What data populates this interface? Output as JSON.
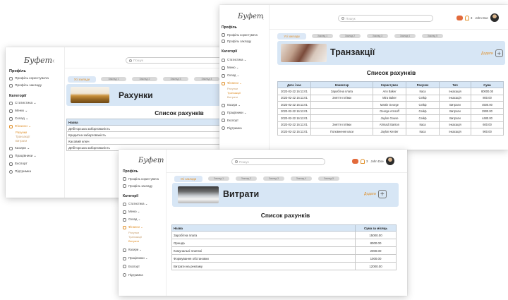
{
  "common": {
    "logo": "Буфет",
    "collapse": "‹",
    "profile_section": "Профіль",
    "profile_items": [
      "Профіль користувача",
      "Профіль закладу"
    ],
    "categories_section": "Категорії",
    "search_placeholder": "Пошук",
    "cart_count": "3",
    "user_name": "John Doe",
    "add_label": "Додати",
    "plus": "+",
    "tabs": [
      "Усі заклади",
      "Заклад 1",
      "Заклад 2",
      "Заклад 3",
      "Заклад 4",
      "Заклад 5"
    ],
    "accent": "#e0902a"
  },
  "window_accounts": {
    "sidebar": [
      "Статистика ⌄",
      "Меню ⌄",
      "Склад ⌄",
      "Фінанси ⌄",
      "Касири ⌄",
      "Працівники ⌄",
      "Експорт",
      "Підтримка"
    ],
    "finance_sub": [
      "Рахунки",
      "Транзакції",
      "Витрати"
    ],
    "banner_title": "Рахунки",
    "list_title": "Список рахунків",
    "table_header": [
      "Назва"
    ],
    "rows": [
      [
        "Дебіторська заборгованість"
      ],
      [
        "Кредитна заборгованість"
      ],
      [
        "Касовий ключ"
      ],
      [
        "Дебіторська заборгованість"
      ]
    ]
  },
  "window_transactions": {
    "sidebar": [
      "Статистика ⌄",
      "Меню ⌄",
      "Склад ⌄",
      "Фінанси ⌄",
      "Касири ⌄",
      "Працівники ⌄",
      "Експорт",
      "Підтримка"
    ],
    "finance_sub": [
      "Рахунки",
      "Транзакції",
      "Витрати"
    ],
    "banner_title": "Транзакції",
    "list_title": "Список рахунків",
    "table_header": [
      "Дата і час",
      "Коментар",
      "Користувач",
      "Рахунок",
      "Тип",
      "Сума"
    ],
    "rows": [
      [
        "2023-02-22 16:11:01",
        "Заробітна плата",
        "Ann Baker",
        "Каса",
        "Інкасація",
        "80000.00"
      ],
      [
        "2023-02-22 16:11:01",
        "Зняття готівки",
        "Mira Baker",
        "Сейф",
        "Інкасація",
        "800.00"
      ],
      [
        "2023-02-22 16:11:01",
        "",
        "Martin George",
        "Сейф",
        "Витрати",
        "4500.00"
      ],
      [
        "2023-02-22 16:11:01",
        "",
        "George Arnsoff",
        "Сейф",
        "Витрати",
        "2900.00"
      ],
      [
        "2023-02-22 16:11:01",
        "",
        "Jaylon Gouse",
        "Сейф",
        "Витрати",
        "4480.00"
      ],
      [
        "2023-02-22 16:11:01",
        "Зняття готівки",
        "Ahmad Stanton",
        "Каса",
        "Інкасація",
        "600.00"
      ],
      [
        "2023-02-22 16:11:01",
        "Поповнення каси",
        "Jaylon Kenter",
        "Каса",
        "Інкасація",
        "900.00"
      ]
    ]
  },
  "window_expenses": {
    "sidebar": [
      "Статистика ⌄",
      "Меню ⌄",
      "Склад ⌄",
      "Фінанси ⌄",
      "Касири ⌄",
      "Працівники ⌄",
      "Експорт",
      "Підтримка"
    ],
    "finance_sub": [
      "Рахунки",
      "Транзакції",
      "Витрати"
    ],
    "banner_title": "Витрати",
    "list_title": "Список рахунків",
    "table_header": [
      "Назва",
      "Сума за місяць"
    ],
    "rows": [
      [
        "Заробітна плата",
        "15000.00"
      ],
      [
        "Оренда",
        "8000.00"
      ],
      [
        "Комунальні платежі",
        "2000.00"
      ],
      [
        "Формування обстановки",
        "1000.00"
      ],
      [
        "Витрати на рекламу",
        "12000.00"
      ]
    ]
  }
}
